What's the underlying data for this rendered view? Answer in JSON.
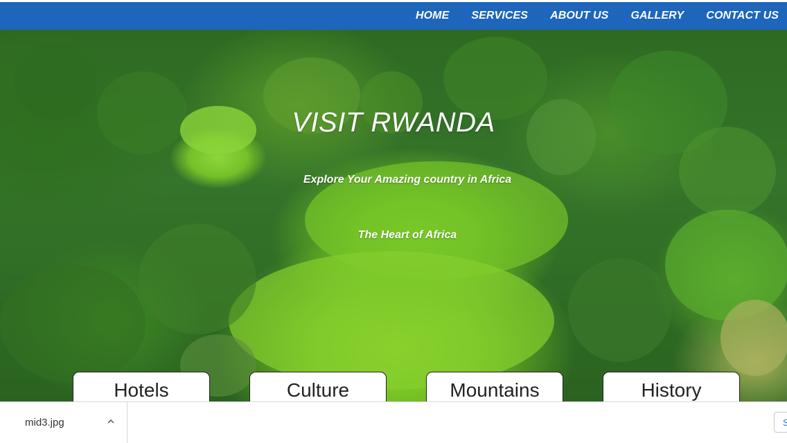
{
  "nav": {
    "items": [
      {
        "label": "HOME"
      },
      {
        "label": "SERVICES"
      },
      {
        "label": "ABOUT US"
      },
      {
        "label": "GALLERY"
      },
      {
        "label": "CONTACT US"
      }
    ]
  },
  "hero": {
    "title": "VISIT RWANDA",
    "subtitle": "Explore Your Amazing country in Africa",
    "tagline": "The Heart of Africa"
  },
  "cards": [
    {
      "label": "Hotels"
    },
    {
      "label": "Culture"
    },
    {
      "label": "Mountains"
    },
    {
      "label": "History"
    }
  ],
  "downloads": {
    "file_name": "mid3.jpg",
    "show_all_label": "S"
  },
  "colors": {
    "nav_bg": "#1e66bb",
    "accent_link": "#1a73e8"
  },
  "icons": {
    "chevron": "chevron-up-icon"
  }
}
